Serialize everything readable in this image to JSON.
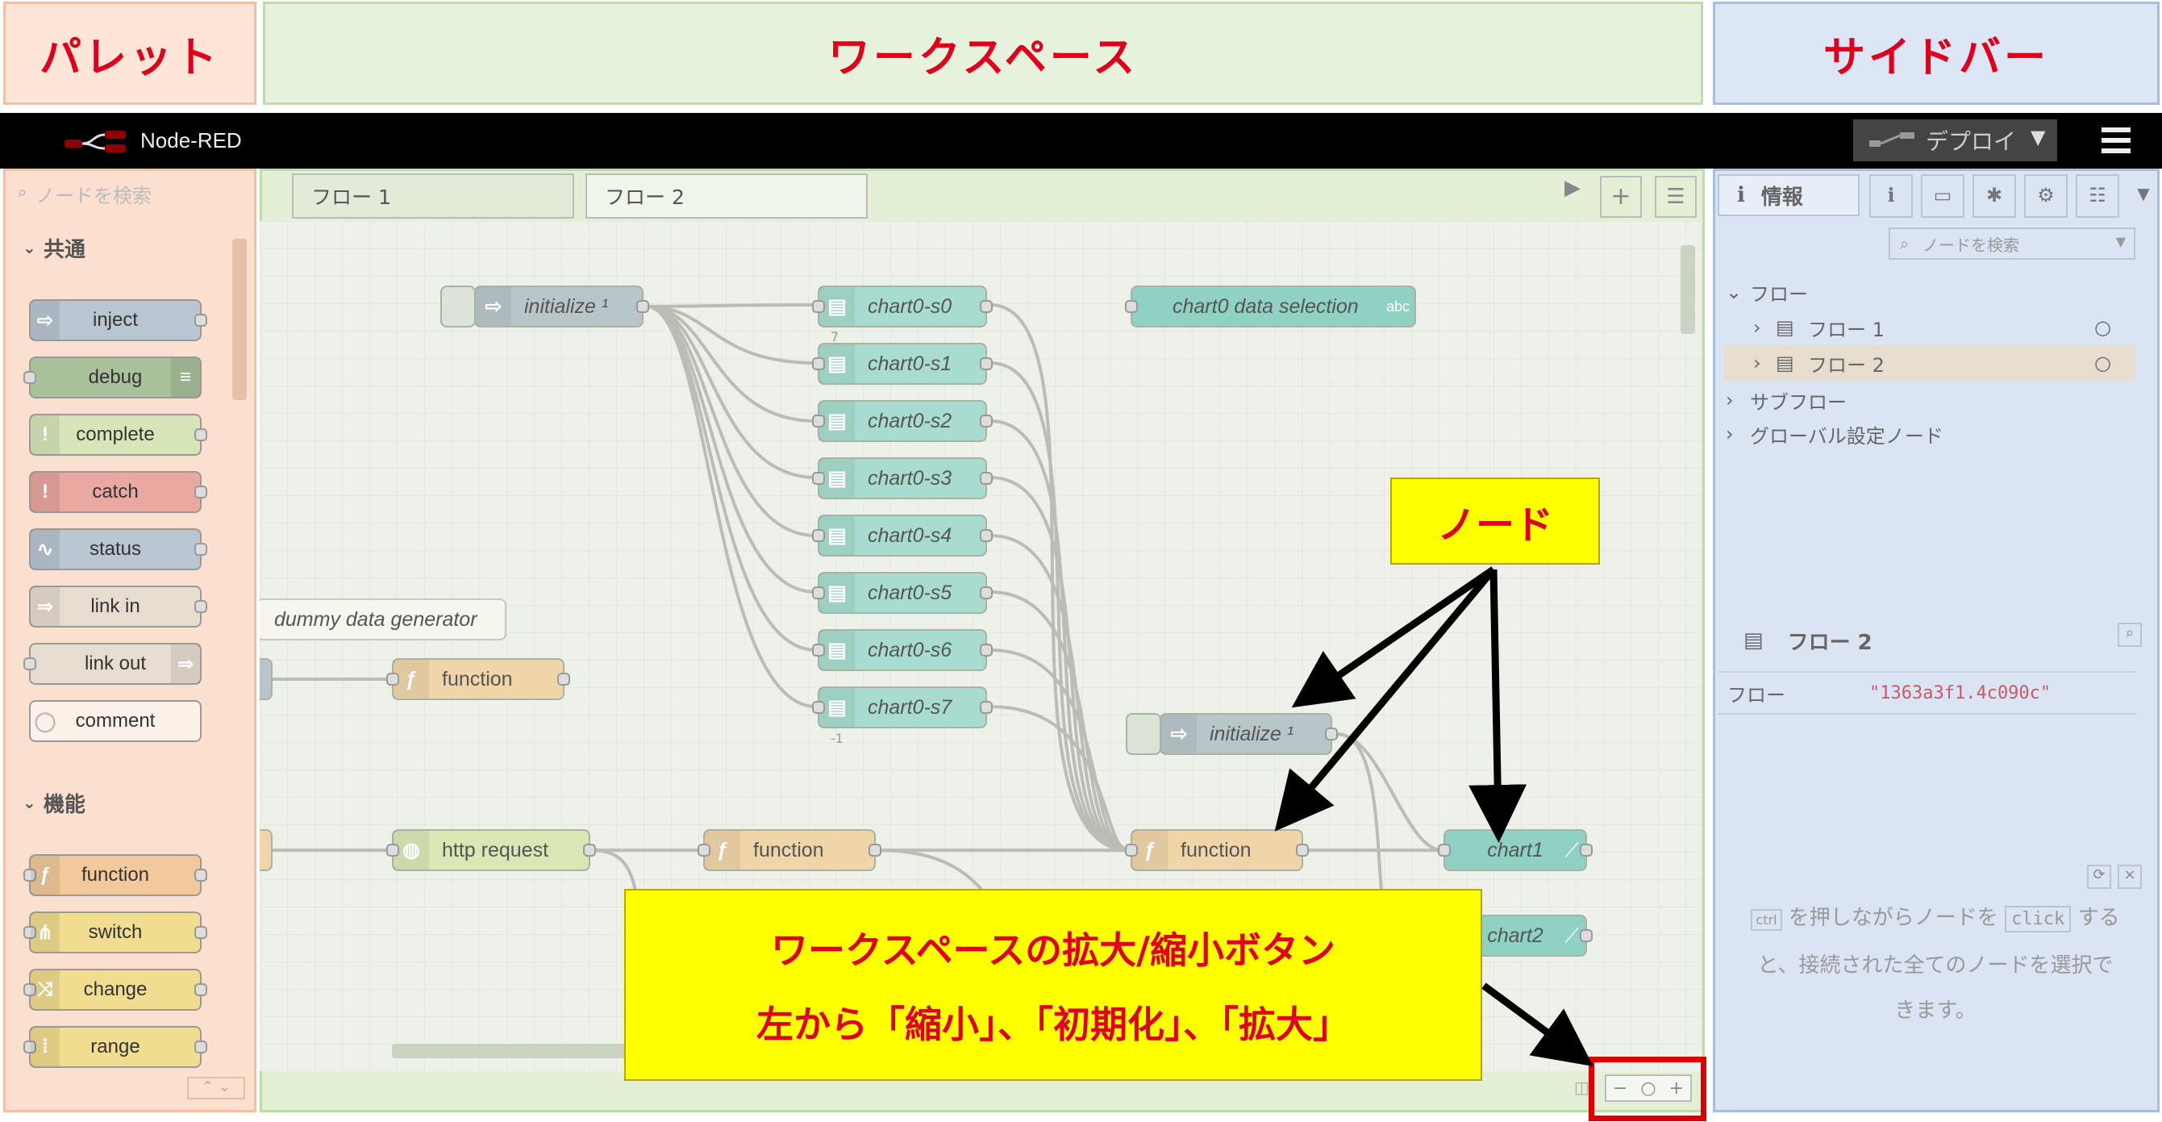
{
  "annotations": {
    "palette": "パレット",
    "workspace": "ワークスペース",
    "sidebar": "サイドバー",
    "node_callout": "ノード",
    "zoom_callout_line1": "ワークスペースの拡大/縮小ボタン",
    "zoom_callout_line2": "左から「縮小」、「初期化」、「拡大」"
  },
  "header": {
    "app_name": "Node-RED",
    "deploy_label": "デプロイ"
  },
  "palette": {
    "search_placeholder": "ノードを検索",
    "categories": [
      {
        "label": "共通",
        "nodes": [
          "inject",
          "debug",
          "complete",
          "catch",
          "status",
          "link in",
          "link out",
          "comment"
        ]
      },
      {
        "label": "機能",
        "nodes": [
          "function",
          "switch",
          "change",
          "range"
        ]
      }
    ]
  },
  "workspace": {
    "tabs": [
      "フロー 1",
      "フロー 2"
    ],
    "nodes": {
      "init1": "initialize ¹",
      "init2": "initialize ¹",
      "charts": [
        "chart0-s0",
        "chart0-s1",
        "chart0-s2",
        "chart0-s3",
        "chart0-s4",
        "chart0-s5",
        "chart0-s6",
        "chart0-s7"
      ],
      "chart_badge_first": "7",
      "chart_badge": "-1",
      "selection": "chart0 data selection",
      "selection_badge": "abc",
      "comment": "dummy data generator",
      "function_a": "function",
      "http": "http request",
      "function_b": "function",
      "function_c": "function",
      "chart1": "chart1",
      "chart2": "chart2"
    }
  },
  "sidebar": {
    "tab_label": "情報",
    "search_placeholder": "ノードを検索",
    "tree": {
      "root": "フロー",
      "flow1": "フロー 1",
      "flow2": "フロー 2",
      "subflow": "サブフロー",
      "global": "グローバル設定ノード"
    },
    "selected_title": "フロー 2",
    "prop_key": "フロー",
    "prop_value": "\"1363a3f1.4c090c\"",
    "tip": {
      "key": "ctrl",
      "text1": "を押しながらノードを",
      "click": "click",
      "text2": "する",
      "text3": "と、接続された全てのノードを選択で",
      "text4": "きます。"
    }
  },
  "colors": {
    "annotation_red": "#e0001c",
    "callout_yellow": "#ffff00",
    "palette_overlay": "#fbe0d0",
    "workspace_overlay": "#e4f0d6",
    "sidebar_overlay": "#dbe4f3"
  }
}
